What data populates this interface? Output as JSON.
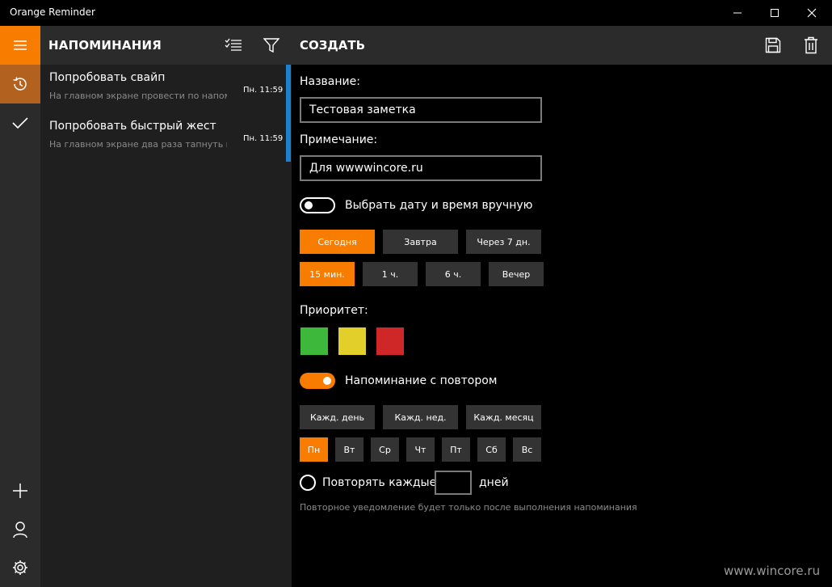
{
  "window": {
    "title": "Orange Reminder",
    "controls": [
      "minimize-icon",
      "maximize-icon",
      "close-icon"
    ]
  },
  "colors": {
    "accent": "#f77c00",
    "accent_dark": "#b3611e",
    "list_marker": "#1e7fd1",
    "priority_green": "#3db83a",
    "priority_yellow": "#e2cf2a",
    "priority_red": "#cf2727"
  },
  "rail": {
    "items": [
      {
        "icon": "hamburger-menu-icon"
      },
      {
        "icon": "history-icon"
      },
      {
        "icon": "checkmark-icon"
      },
      {
        "icon": "add-icon"
      },
      {
        "icon": "person-icon"
      },
      {
        "icon": "settings-gear-icon"
      }
    ]
  },
  "list": {
    "header": "НАПОМИНАНИЯ",
    "header_icons": [
      "select-list-icon",
      "filter-icon"
    ],
    "items": [
      {
        "title": "Попробовать свайп",
        "subtitle": "На главном экране провести по напоми",
        "time": "Пн. 11:59"
      },
      {
        "title": "Попробовать быстрый жест",
        "subtitle": "На главном экране два раза тапнуть по",
        "time": "Пн. 11:59"
      }
    ]
  },
  "main": {
    "header": "СОЗДАТЬ",
    "header_icons": [
      "save-icon",
      "delete-icon"
    ],
    "name_label": "Название:",
    "name_value": "Тестовая заметка",
    "note_label": "Примечание:",
    "note_value": "Для wwwwincore.ru",
    "manual_toggle_label": "Выбрать дату и время вручную",
    "manual_toggle_on": false,
    "day_buttons": [
      "Сегодня",
      "Завтра",
      "Через 7 дн."
    ],
    "day_selected": "Сегодня",
    "time_buttons": [
      "15 мин.",
      "1 ч.",
      "6 ч.",
      "Вечер"
    ],
    "time_selected": "15 мин.",
    "priority_label": "Приоритет:",
    "repeat_toggle_label": "Напоминание с повтором",
    "repeat_toggle_on": true,
    "repeat_buttons": [
      "Кажд. день",
      "Кажд. нед.",
      "Кажд. месяц"
    ],
    "weekday_buttons": [
      "Пн",
      "Вт",
      "Ср",
      "Чт",
      "Пт",
      "Сб",
      "Вс"
    ],
    "weekday_selected": "Пн",
    "repeat_every_label": "Повторять каждые",
    "repeat_every_value": "",
    "repeat_every_unit": "дней",
    "repeat_note": "Повторное уведомление будет только после выполнения напоминания"
  },
  "watermark": "www.wincore.ru"
}
